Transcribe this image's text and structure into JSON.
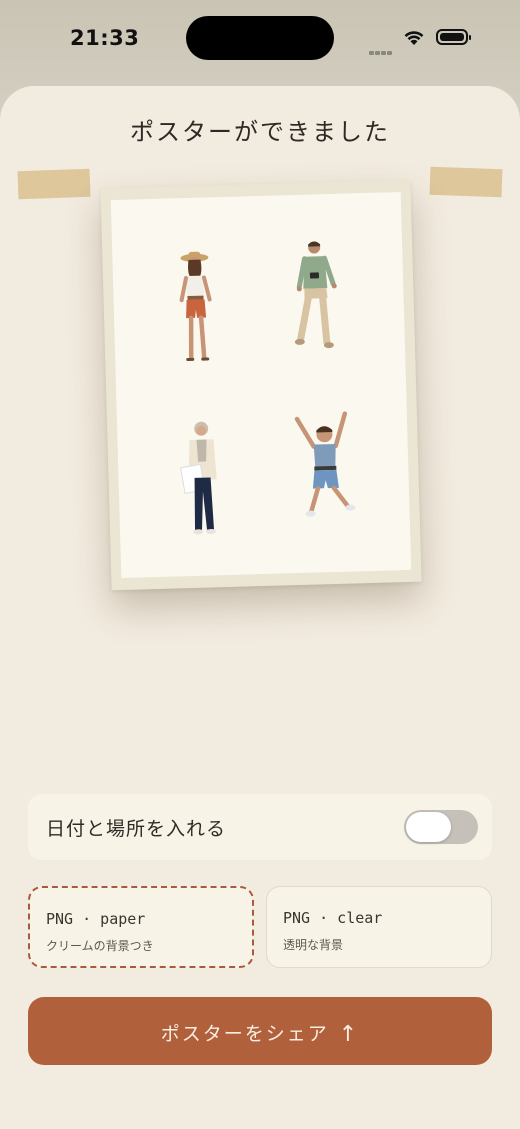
{
  "status_bar": {
    "time": "21:33"
  },
  "sheet": {
    "title": "ポスターができました"
  },
  "poster": {
    "people": [
      "woman-in-hat",
      "man-with-camera",
      "older-woman-with-paper",
      "boy-jumping"
    ]
  },
  "toggle": {
    "label": "日付と場所を入れる",
    "on": false
  },
  "options": [
    {
      "title": "PNG · paper",
      "subtitle": "クリームの背景つき",
      "selected": true
    },
    {
      "title": "PNG · clear",
      "subtitle": "透明な背景",
      "selected": false
    }
  ],
  "share": {
    "label": "ポスターをシェア",
    "icon": "arrow-up-icon"
  },
  "colors": {
    "accent": "#b1603c",
    "sheet_bg": "#f2ebdf"
  }
}
